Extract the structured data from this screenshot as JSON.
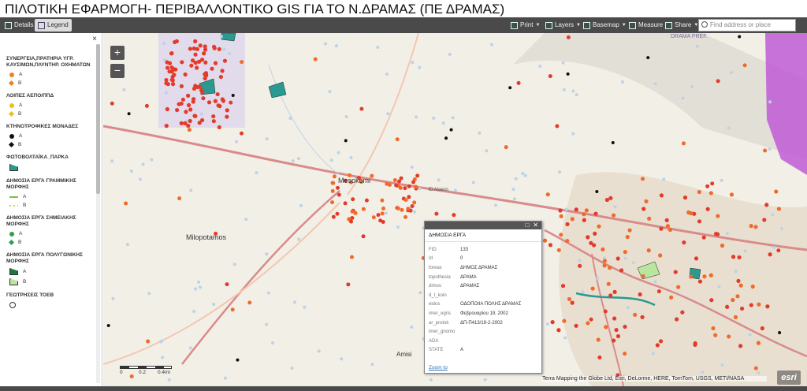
{
  "app": {
    "title": "ΠΙΛΟΤΙΚΗ ΕΦΑΡΜΟΓΗ- ΠΕΡΙΒΑΛΛΟΝΤΙΚΟ GIS ΓΙΑ ΤΟ Ν.ΔΡΑΜΑΣ (ΠΕ ΔΡΑΜΑΣ)"
  },
  "toolbar": {
    "details": "Details",
    "legend": "Legend",
    "print": "Print",
    "layers": "Layers",
    "basemap": "Basemap",
    "measure": "Measure",
    "share": "Share",
    "search_placeholder": "Find address or place"
  },
  "legend": {
    "close": "×",
    "groups": [
      {
        "title": "ΣΥΝΕΡΓΕΙΑ,ΠΡΑΤΗΡΙΑ ΥΓΡ. ΚΑΥΣΙΜΩΝ,ΠΛΥΝΤΗΡ. ΟΧΗΜΑΤΩΝ",
        "items": [
          {
            "label": "A",
            "color": "#e8842a",
            "shape": "circle"
          },
          {
            "label": "B",
            "color": "#e8842a",
            "shape": "diamond"
          }
        ]
      },
      {
        "title": "ΛΟΙΠΕΣ ΑΕΠΟ/ΠΠΔ",
        "items": [
          {
            "label": "A",
            "color": "#e8c21a",
            "shape": "circle"
          },
          {
            "label": "B",
            "color": "#e8c21a",
            "shape": "diamond"
          }
        ]
      },
      {
        "title": "ΚΤΗΝΟΤΡΟΦΙΚΕΣ ΜΟΝΑΔΕΣ",
        "items": [
          {
            "label": "A",
            "color": "#111111",
            "shape": "circle"
          },
          {
            "label": "B",
            "color": "#111111",
            "shape": "diamond"
          }
        ]
      },
      {
        "title": "ΦΩΤΟΒΟΛΤΑΪΚΑ_ΠΑΡΚΑ",
        "items": [
          {
            "label": "",
            "color": "#2a9a90",
            "shape": "poly"
          }
        ]
      },
      {
        "title": "ΔΗΜΟΣΙΑ ΕΡΓΑ ΓΡΑΜΜΙΚΗΣ ΜΟΡΦΗΣ",
        "items": [
          {
            "label": "A",
            "color": "#7cc24a",
            "shape": "line"
          },
          {
            "label": "B",
            "color": "#b7d86a",
            "shape": "dash"
          }
        ]
      },
      {
        "title": "ΔΗΜΟΣΙΑ ΕΡΓΑ ΣΗΜΕΙΑΚΗΣ ΜΟΡΦΗΣ",
        "items": [
          {
            "label": "A",
            "color": "#2ea04a",
            "shape": "circle"
          },
          {
            "label": "B",
            "color": "#2ea04a",
            "shape": "diamond"
          }
        ]
      },
      {
        "title": "ΔΗΜΟΣΙΑ ΕΡΓΑ ΠΟΛΥΓΩΝΙΚΗΣ ΜΟΡΦΗΣ",
        "items": [
          {
            "label": "A",
            "color": "#1e7a3a",
            "shape": "poly"
          },
          {
            "label": "B",
            "color": "#b8e6a0",
            "shape": "poly"
          }
        ]
      },
      {
        "title": "ΓΕΩΤΡΗΣΕΙΣ ΤΟΕΒ",
        "items": [
          {
            "label": "",
            "color": "#333333",
            "shape": "ring"
          }
        ]
      }
    ]
  },
  "map": {
    "zoom_in": "+",
    "zoom_out": "−",
    "labels": [
      "Mesokomi",
      "Milopotamos",
      "El Alaeos",
      "Amisi"
    ],
    "region_label": "DRAMA PREF.",
    "scale": {
      "labels": [
        "0",
        "0.2",
        "0.4mi"
      ]
    },
    "attribution": "Terra Mapping the Globe Ltd, Esri, DeLorme, HERE, TomTom, USGS, METI/NASA",
    "logo": "esri",
    "colors": {
      "orange": "#f06a2a",
      "red": "#e33b2b",
      "road": "#d98b8b",
      "lightroad": "#f3c7b0",
      "point": "#bcd3e6",
      "urban": "#e9e1d6",
      "purple": "#c05cd6"
    }
  },
  "popup": {
    "title": "ΔΗΜΟΣΙΑ ΕΡΓΑ",
    "fields": [
      {
        "k": "FID",
        "v": "133"
      },
      {
        "k": "Id",
        "v": "0"
      },
      {
        "k": "foreas",
        "v": "ΔΗΜΟΣ ΔΡΑΜΑΣ"
      },
      {
        "k": "topothesia",
        "v": "ΔΡΑΜΑ"
      },
      {
        "k": "dimos",
        "v": "ΔΡΑΜΑΣ"
      },
      {
        "k": "d_t_koin",
        "v": ""
      },
      {
        "k": "eidos",
        "v": "ΟΔΟΠΟΙΙΑ ΠΟΛΗΣ ΔΡΑΜΑΣ"
      },
      {
        "k": "imer_egris",
        "v": "Φεβρουαρίου 19, 2002"
      },
      {
        "k": "ar_protok",
        "v": "ΔΠ-Π413/19-2-2002"
      },
      {
        "k": "imer_gnomo",
        "v": ""
      },
      {
        "k": "ADA",
        "v": ""
      },
      {
        "k": "STATE",
        "v": "A"
      }
    ],
    "zoom_link": "Zoom to"
  }
}
